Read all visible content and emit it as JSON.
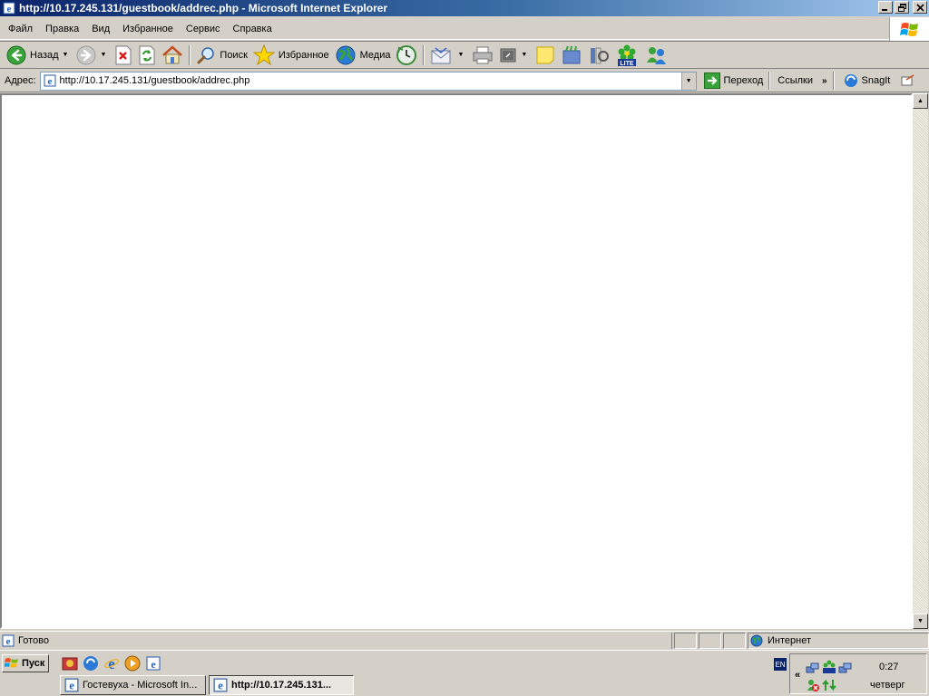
{
  "window": {
    "title": "http://10.17.245.131/guestbook/addrec.php - Microsoft Internet Explorer",
    "minimize_icon": "minimize-icon",
    "restore_icon": "restore-icon",
    "close_icon": "close-icon"
  },
  "menu": {
    "items": [
      "Файл",
      "Правка",
      "Вид",
      "Избранное",
      "Сервис",
      "Справка"
    ]
  },
  "toolbar": {
    "back_label": "Назад",
    "search_label": "Поиск",
    "favorites_label": "Избранное",
    "media_label": "Медиа",
    "icon_lite_text": "LITE"
  },
  "address": {
    "label": "Адрес:",
    "url": "http://10.17.245.131/guestbook/addrec.php",
    "go_label": "Переход",
    "links_label": "Ссылки",
    "snagit_label": "SnagIt"
  },
  "status": {
    "text": "Готово",
    "zone": "Интернет"
  },
  "taskbar": {
    "start_label": "Пуск",
    "tasks": [
      {
        "label": "Гостевуха - Microsoft In..."
      },
      {
        "label": "http://10.17.245.131..."
      }
    ],
    "lang": "EN",
    "expand": "«",
    "clock": "0:27",
    "day": "четверг"
  },
  "colors": {
    "titlebar_start": "#0a246a",
    "titlebar_end": "#a6caf0",
    "chrome": "#d4d0c8",
    "content_bg": "#ffffff"
  }
}
